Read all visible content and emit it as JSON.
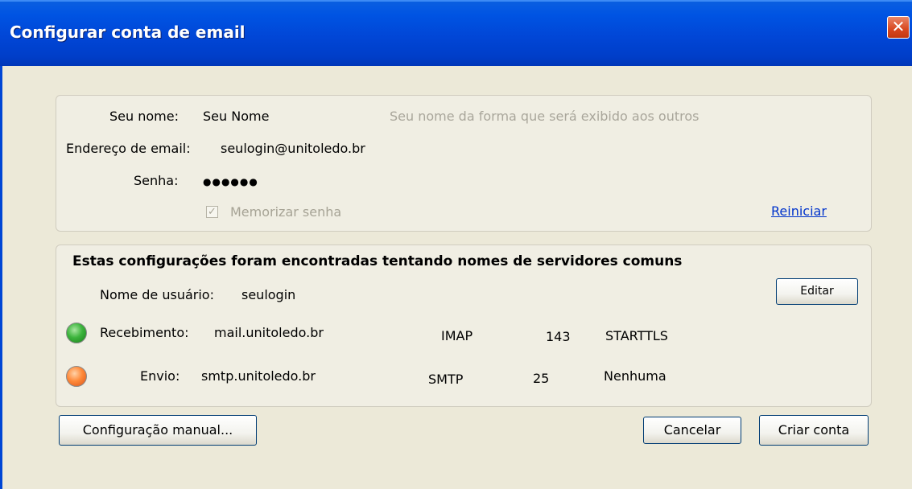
{
  "window": {
    "title": "Configurar conta de email",
    "close_label": "✕"
  },
  "account": {
    "name_label": "Seu nome:",
    "name_value": "Seu Nome",
    "name_hint": "Seu nome da forma que será exibido aos outros",
    "email_label": "Endereço de email:",
    "email_value": "seulogin@unitoledo.br",
    "password_label": "Senha:",
    "password_value": "●●●●●●",
    "remember_label": "Memorizar senha",
    "remember_checked": true,
    "reset_link": "Reiniciar"
  },
  "servers": {
    "heading": "Estas configurações foram encontradas tentando nomes de servidores comuns",
    "username_label": "Nome de usuário:",
    "username_value": "seulogin",
    "edit_button": "Editar",
    "incoming": {
      "label": "Recebimento:",
      "host": "mail.unitoledo.br",
      "protocol": "IMAP",
      "port": "143",
      "security": "STARTTLS",
      "status_color": "#2ea82e"
    },
    "outgoing": {
      "label": "Envio:",
      "host": "smtp.unitoledo.br",
      "protocol": "SMTP",
      "port": "25",
      "security": "Nenhuma",
      "status_color": "#ff7f2a"
    }
  },
  "buttons": {
    "manual": "Configuração manual...",
    "cancel": "Cancelar",
    "create": "Criar conta"
  }
}
